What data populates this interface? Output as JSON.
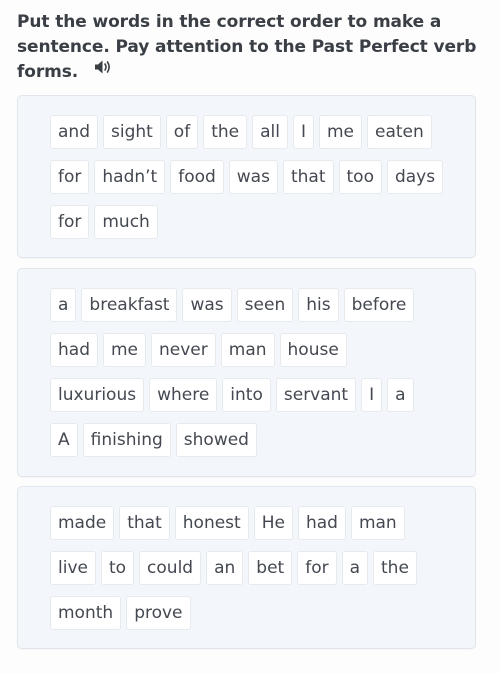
{
  "instructions": {
    "text": "Put the words in the correct order to make a sentence. Pay attention to the Past Perfect verb forms.",
    "audio_icon": "speaker-icon"
  },
  "exercises": [
    {
      "words": [
        "and",
        "sight",
        "of",
        "the",
        "all",
        "I",
        "me",
        "eaten",
        "for",
        "hadn’t",
        "food",
        "was",
        "that",
        "too",
        "days",
        "for",
        "much"
      ]
    },
    {
      "words": [
        "a",
        "breakfast",
        "was",
        "seen",
        "his",
        "before",
        "had",
        "me",
        "never",
        "man",
        "house",
        "luxurious",
        "where",
        "into",
        "servant",
        "I",
        "a",
        "A",
        "finishing",
        "showed"
      ]
    },
    {
      "words": [
        "made",
        "that",
        "honest",
        "He",
        "had",
        "man",
        "live",
        "to",
        "could",
        "an",
        "bet",
        "for",
        "a",
        "the",
        "month",
        "prove"
      ]
    }
  ],
  "colors": {
    "panel_bg": "#f3f7fb",
    "tile_bg": "#ffffff",
    "text": "#444851",
    "heading": "#3a3e45"
  }
}
